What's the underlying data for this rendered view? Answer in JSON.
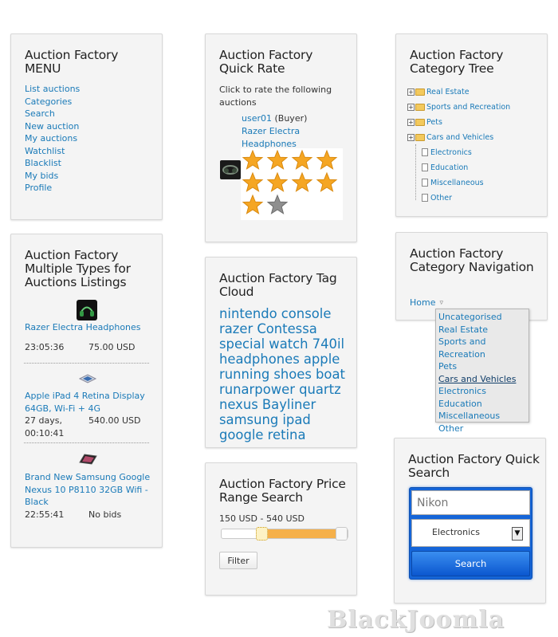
{
  "menu": {
    "title": "Auction Factory MENU",
    "items": [
      "List auctions",
      "Categories",
      "Search",
      "New auction",
      "My auctions",
      "Watchlist",
      "Blacklist",
      "My bids",
      "Profile"
    ]
  },
  "quick_rate": {
    "title": "Auction Factory Quick Rate",
    "intro": "Click to rate the following auctions",
    "user": "user01",
    "role": "(Buyer)",
    "product_line1": "Razer Electra",
    "product_line2": "Headphones",
    "rating_stars": 10,
    "filled_stars": 9
  },
  "category_tree": {
    "title": "Auction Factory Category Tree",
    "folders": [
      "Real Estate",
      "Sports and Recreation",
      "Pets",
      "Cars and Vehicles"
    ],
    "files": [
      "Electronics",
      "Education",
      "Miscellaneous",
      "Other"
    ]
  },
  "listings": {
    "title": "Auction Factory Multiple Types for Auctions Listings",
    "items": [
      {
        "name": "Razer Electra Headphones",
        "time": "23:05:36",
        "price": "75.00 USD"
      },
      {
        "name": "Apple iPad 4 Retina Display 64GB, Wi-Fi + 4G",
        "time": "27 days, 00:10:41",
        "price": "540.00 USD"
      },
      {
        "name": "Brand New Samsung Google Nexus 10 P8110 32GB Wifi - Black",
        "time": "22:55:41",
        "price": "No bids"
      }
    ]
  },
  "tag_cloud": {
    "title": "Auction Factory Tag Cloud",
    "tags": [
      "nintendo",
      "console",
      "razer",
      "Contessa",
      "special",
      "watch",
      "740il",
      "headphones",
      "apple",
      "running",
      "shoes",
      "boat",
      "runarpower",
      "quartz",
      "nexus",
      "Bayliner",
      "samsung",
      "ipad",
      "google",
      "retina"
    ]
  },
  "category_nav": {
    "title": "Auction Factory Category Navigation",
    "home": "Home",
    "options": [
      "Uncategorised",
      "Real Estate",
      "Sports and Recreation",
      "Pets",
      "Cars and Vehicles",
      "Electronics",
      "Education",
      "Miscellaneous",
      "Other"
    ],
    "hovered": "Cars and Vehicles"
  },
  "price_range": {
    "title": "Auction Factory Price Range Search",
    "range_text": "150 USD - 540 USD",
    "range_min_fraction": 0.3,
    "range_max_fraction": 1.0,
    "filter_label": "Filter"
  },
  "quick_search": {
    "title": "Auction Factory Quick Search",
    "keyword_value": "Nikon",
    "category_value": "Electronics",
    "search_label": "Search"
  },
  "watermark": "BlackJoomla",
  "colors": {
    "link": "#1a7ab8",
    "star": "#f5a623",
    "slider": "#f5b04a",
    "search_blue": "#1565d8"
  }
}
